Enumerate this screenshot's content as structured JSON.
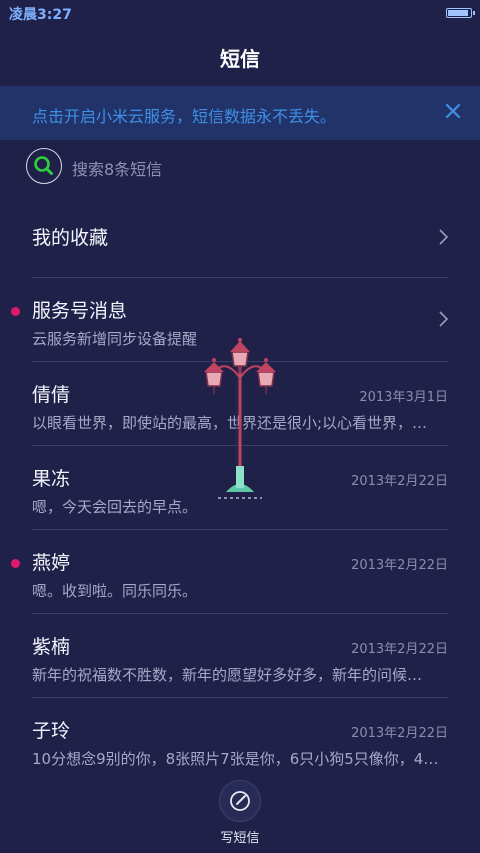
{
  "status_bar": {
    "time": "凌晨3:27",
    "battery_level": 0.92
  },
  "header": {
    "title": "短信"
  },
  "banner": {
    "text": "点击开启小米云服务，短信数据永不丢失。",
    "close_icon": "close-icon"
  },
  "search": {
    "placeholder": "搜索8条短信",
    "icon": "search-icon"
  },
  "list": [
    {
      "name": "我的收藏",
      "preview": "",
      "date": "",
      "unread": false,
      "has_chevron": true
    },
    {
      "name": "服务号消息",
      "preview": "云服务新增同步设备提醒",
      "date": "",
      "unread": true,
      "has_chevron": true
    },
    {
      "name": "倩倩",
      "preview": "以眼看世界，即使站的最高，世界还是很小;以心看世界，…",
      "date": "2013年3月1日",
      "unread": false,
      "has_chevron": false
    },
    {
      "name": "果冻",
      "preview": "嗯，今天会回去的早点。",
      "date": "2013年2月22日",
      "unread": false,
      "has_chevron": false
    },
    {
      "name": "燕婷",
      "preview": "嗯。收到啦。同乐同乐。",
      "date": "2013年2月22日",
      "unread": true,
      "has_chevron": false
    },
    {
      "name": "紫楠",
      "preview": "新年的祝福数不胜数，新年的愿望好多好多，新年的问候…",
      "date": "2013年2月22日",
      "unread": false,
      "has_chevron": false
    },
    {
      "name": "子玲",
      "preview": "10分想念9别的你，8张照片7张是你，6只小狗5只像你，4…",
      "date": "2013年2月22日",
      "unread": false,
      "has_chevron": false
    }
  ],
  "compose": {
    "label": "写短信",
    "icon": "compose-icon"
  },
  "colors": {
    "background": "#1f2149",
    "banner_bg": "#22336a",
    "banner_text": "#3f8fe6",
    "unread_dot": "#e0186d",
    "search_icon": "#2fcf3c"
  }
}
